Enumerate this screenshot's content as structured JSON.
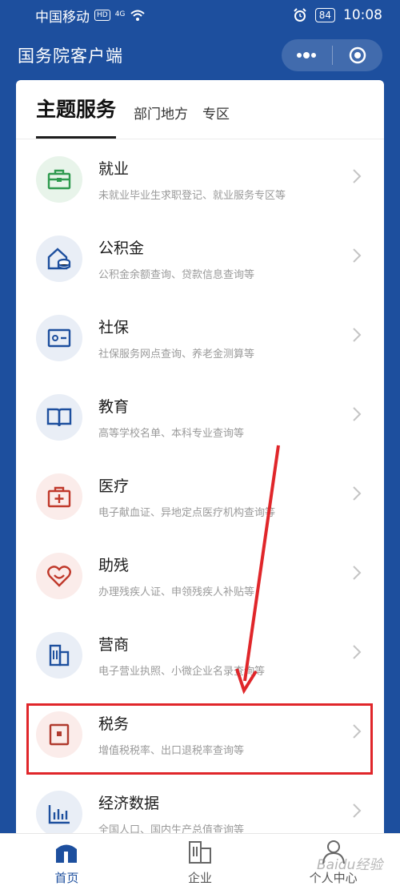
{
  "status_bar": {
    "carrier": "中国移动",
    "hd": "HD",
    "network": "4G",
    "battery": "84",
    "time": "10:08"
  },
  "header": {
    "title": "国务院客户端"
  },
  "tabs": [
    "主题服务",
    "部门地方",
    "专区"
  ],
  "services": [
    {
      "title": "就业",
      "desc": "未就业毕业生求职登记、就业服务专区等",
      "icon": "briefcase-icon",
      "color": "#2f9a4f"
    },
    {
      "title": "公积金",
      "desc": "公积金余额查询、贷款信息查询等",
      "icon": "house-coins-icon",
      "color": "#1d4f9e"
    },
    {
      "title": "社保",
      "desc": "社保服务网点查询、养老金测算等",
      "icon": "id-card-icon",
      "color": "#1d4f9e"
    },
    {
      "title": "教育",
      "desc": "高等学校名单、本科专业查询等",
      "icon": "book-icon",
      "color": "#1d4f9e"
    },
    {
      "title": "医疗",
      "desc": "电子献血证、异地定点医疗机构查询等",
      "icon": "medical-kit-icon",
      "color": "#c0392b"
    },
    {
      "title": "助残",
      "desc": "办理残疾人证、申领残疾人补贴等",
      "icon": "heart-icon",
      "color": "#c0392b"
    },
    {
      "title": "营商",
      "desc": "电子营业执照、小微企业名录查询等",
      "icon": "building-icon",
      "color": "#1d4f9e"
    },
    {
      "title": "税务",
      "desc": "增值税税率、出口退税率查询等",
      "icon": "tax-document-icon",
      "color": "#b03a2e"
    },
    {
      "title": "经济数据",
      "desc": "全国人口、国内生产总值查询等",
      "icon": "bar-chart-icon",
      "color": "#1d4f9e"
    }
  ],
  "nav": {
    "items": [
      {
        "label": "首页",
        "icon": "home-icon",
        "active": true
      },
      {
        "label": "企业",
        "icon": "building-icon",
        "active": false
      },
      {
        "label": "个人中心",
        "icon": "person-icon",
        "active": false
      }
    ]
  },
  "watermark": "Baidu经验"
}
